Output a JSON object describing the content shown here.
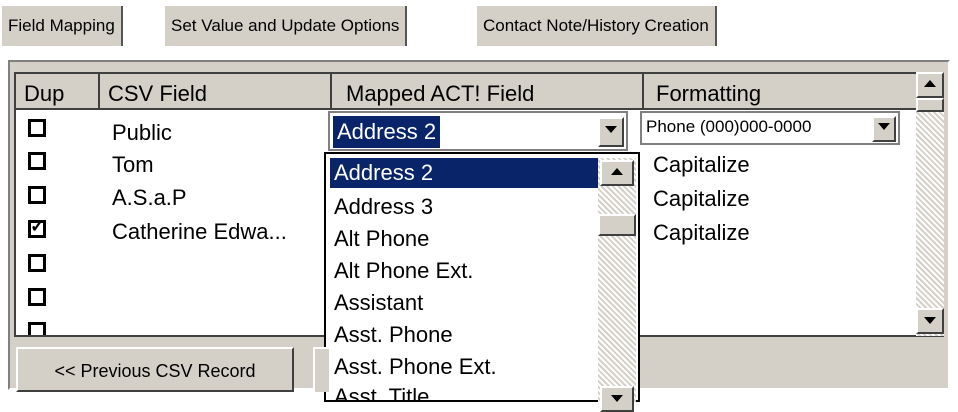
{
  "tabs": [
    {
      "label": "Field Mapping",
      "active": true
    },
    {
      "label": "Set Value and Update Options",
      "active": false
    },
    {
      "label": "Contact Note/History Creation",
      "active": false
    }
  ],
  "grid": {
    "headers": [
      "Dup",
      "CSV Field",
      "Mapped ACT! Field",
      "Formatting"
    ],
    "rows": [
      {
        "dup": false,
        "csv": "Public"
      },
      {
        "dup": false,
        "csv": "Tom"
      },
      {
        "dup": false,
        "csv": "A.S.a.P"
      },
      {
        "dup": true,
        "csv": "Catherine Edwa..."
      },
      {
        "dup": false,
        "csv": ""
      },
      {
        "dup": false,
        "csv": ""
      },
      {
        "dup": false,
        "csv": ""
      }
    ],
    "formatting": [
      "Capitalize",
      "Capitalize",
      "Capitalize"
    ]
  },
  "mapped_combo": {
    "value": "Address 2"
  },
  "format_combo": {
    "value": "Phone (000)000-0000"
  },
  "dropdown": {
    "items": [
      "Address 2",
      "Address 3",
      "Alt Phone",
      "Alt Phone Ext.",
      "Assistant",
      "Asst. Phone",
      "Asst. Phone Ext.",
      "Asst. Title"
    ],
    "selected": "Address 2"
  },
  "buttons": {
    "previous_label": "<< Previous CSV Record"
  },
  "colors": {
    "selection": "#0a246a",
    "face": "#d4d0c8"
  }
}
